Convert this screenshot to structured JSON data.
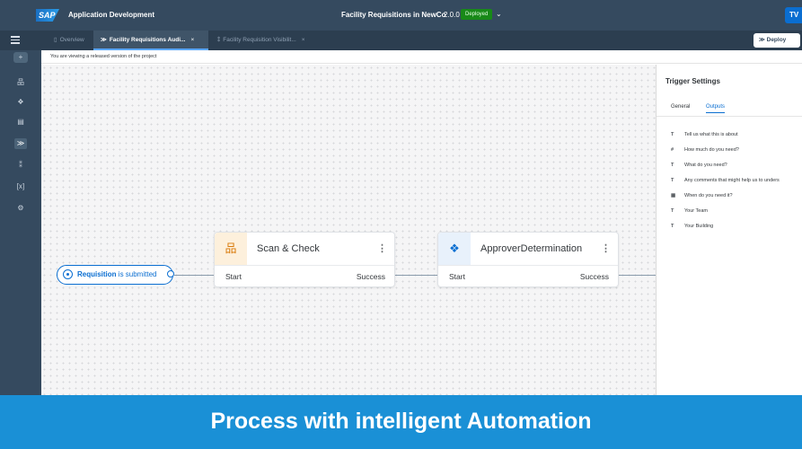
{
  "colors": {
    "shell": "#354a5f",
    "accent": "#0a6ed1",
    "deployed": "#188918",
    "banner": "#1a90d6"
  },
  "shell": {
    "logo": "SAP",
    "app_title": "Application Development",
    "project_title": "Facility Requisitions in NewCo",
    "version": "2.0.0",
    "status_badge": "Deployed",
    "avatar_initials": "TV"
  },
  "tabs": [
    {
      "label": "Overview",
      "icon": "document-icon"
    },
    {
      "label": "Facility Requisitions Audi...",
      "icon": "process-icon",
      "close": "×"
    },
    {
      "label": "Facility Requisition Visibilit...",
      "icon": "visibility-icon",
      "close": "×"
    }
  ],
  "toolbar": {
    "deploy_label": "Deploy"
  },
  "info_strip": "You are viewing a released version of the project",
  "canvas": {
    "trigger": {
      "name": "Requisition",
      "suffix": " is submitted"
    },
    "steps": [
      {
        "title": "Scan & Check",
        "start": "Start",
        "success": "Success",
        "icon": "org-chart-icon",
        "menu": "⋮"
      },
      {
        "title": "ApproverDetermination",
        "start": "Start",
        "success": "Success",
        "icon": "decision-icon",
        "menu": "⋮"
      }
    ]
  },
  "panel": {
    "title": "Trigger Settings",
    "tabs": [
      "General",
      "Outputs"
    ],
    "active_tab": "Outputs",
    "outputs": [
      {
        "type": "T",
        "label": "Tell us what this is about"
      },
      {
        "type": "#",
        "label": "How much do you need?"
      },
      {
        "type": "T",
        "label": "What do you need?"
      },
      {
        "type": "T",
        "label": "Any comments that might help us to unders"
      },
      {
        "type": "▦",
        "label": "When do you need it?"
      },
      {
        "type": "T",
        "label": "Your Team"
      },
      {
        "type": "T",
        "label": "Your Building"
      }
    ]
  },
  "banner": "Process with intelligent Automation"
}
